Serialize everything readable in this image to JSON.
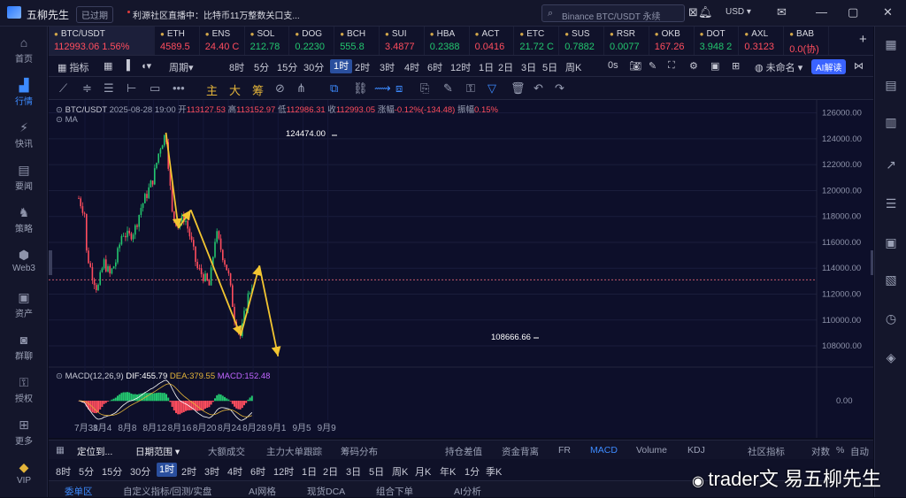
{
  "titlebar": {
    "app_name": "五柳先生",
    "badge": "已过期",
    "news": "利源社区直播中：比特币11万整数关口支...",
    "search_placeholder": "Binance BTC/USDT 永续",
    "currency": "USD"
  },
  "leftnav": [
    {
      "label": "首页",
      "icon": "home-icon"
    },
    {
      "label": "行情",
      "icon": "market-chart-icon",
      "active": true
    },
    {
      "label": "快讯",
      "icon": "flash-news-icon"
    },
    {
      "label": "要闻",
      "icon": "newspaper-icon"
    },
    {
      "label": "策略",
      "icon": "strategy-icon"
    },
    {
      "label": "Web3",
      "icon": "web3-icon"
    },
    {
      "label": "资产",
      "icon": "wallet-icon"
    },
    {
      "label": "群聊",
      "icon": "group-chat-icon"
    },
    {
      "label": "授权",
      "icon": "authorize-icon"
    },
    {
      "label": "更多",
      "icon": "more-grid-icon"
    },
    {
      "label": "VIP",
      "icon": "vip-diamond-icon"
    }
  ],
  "tickers": [
    {
      "name": "BTC/USDT",
      "price": "112993.06 1.56%",
      "dir": "dn"
    },
    {
      "name": "ETH",
      "price": "4589.5",
      "dir": "dn"
    },
    {
      "name": "ENS",
      "price": "24.40 C",
      "dir": "dn"
    },
    {
      "name": "SOL",
      "price": "212.78",
      "dir": "up"
    },
    {
      "name": "DOG",
      "price": "0.2230",
      "dir": "up"
    },
    {
      "name": "BCH",
      "price": "555.8",
      "dir": "up"
    },
    {
      "name": "SUI",
      "price": "3.4877",
      "dir": "dn"
    },
    {
      "name": "HBA",
      "price": "0.2388",
      "dir": "up"
    },
    {
      "name": "ACT",
      "price": "0.0416",
      "dir": "dn"
    },
    {
      "name": "ETC",
      "price": "21.72 C",
      "dir": "up"
    },
    {
      "name": "SUS",
      "price": "0.7882",
      "dir": "up"
    },
    {
      "name": "RSR",
      "price": "0.0077",
      "dir": "up"
    },
    {
      "name": "OKB",
      "price": "167.26",
      "dir": "dn"
    },
    {
      "name": "DOT",
      "price": "3.948 2",
      "dir": "up"
    },
    {
      "name": "AXL",
      "price": "0.3123",
      "dir": "dn"
    },
    {
      "name": "BAB",
      "price": "0.0(协)",
      "dir": "dn"
    }
  ],
  "toolbar1": {
    "items": [
      "指标",
      "周期",
      "8时",
      "5分",
      "15分",
      "30分",
      "1时",
      "2时",
      "3时",
      "4时",
      "6时",
      "12时",
      "1日",
      "2日",
      "3日",
      "5日",
      "周K",
      "0s"
    ],
    "selected": "1时",
    "layout_name": "未命名",
    "ai_button": "AI解读"
  },
  "toolbar2": {
    "gold_labels": [
      "主",
      "大",
      "筹"
    ]
  },
  "chart_info": {
    "symbol": "BTC/USDT",
    "datetime": "2025-08-28 19:00",
    "open_label": "开",
    "open": "113127.53",
    "high_label": "高",
    "high": "113152.97",
    "low_label": "低",
    "low": "112986.31",
    "close_label": "收",
    "close": "112993.05",
    "change_label": "涨幅",
    "change": "-0.12%(-134.48)",
    "amp_label": "振幅",
    "amp": "0.15%",
    "ma": "MA",
    "macd_title": "MACD(12,26,9)",
    "dif": "DIF:455.79",
    "dea": "DEA:379.55",
    "macd": "MACD:152.48",
    "high_annotation": "124474.00",
    "low_annotation": "108666.66"
  },
  "chart_data": {
    "type": "candlestick",
    "y_ticks": [
      "126000.00",
      "124000.00",
      "122000.00",
      "120000.00",
      "118000.00",
      "116000.00",
      "114000.00",
      "112000.00",
      "110000.00",
      "108000.00"
    ],
    "macd_tick": "0.00",
    "x_labels": [
      "7月31",
      "8月4",
      "8月8",
      "8月12",
      "8月16",
      "8月20",
      "8月24",
      "8月28",
      "9月1",
      "9月5",
      "9月9"
    ],
    "ylim": [
      106500,
      127000
    ],
    "price_path": [
      [
        "7月30",
        119400
      ],
      [
        "7月31",
        118200
      ],
      [
        "8月1",
        115700
      ],
      [
        "8月2",
        113800
      ],
      [
        "8月3",
        112300
      ],
      [
        "8月4",
        114500
      ],
      [
        "8月5",
        113500
      ],
      [
        "8月6",
        114600
      ],
      [
        "8月7",
        116800
      ],
      [
        "8月8",
        116400
      ],
      [
        "8月9",
        117000
      ],
      [
        "8月10",
        118700
      ],
      [
        "8月11",
        119800
      ],
      [
        "8月12",
        121000
      ],
      [
        "8月13",
        123300
      ],
      [
        "8月14",
        124474
      ],
      [
        "8月15",
        118200
      ],
      [
        "8月16",
        117300
      ],
      [
        "8月17",
        118000
      ],
      [
        "8月18",
        116200
      ],
      [
        "8月19",
        114000
      ],
      [
        "8月20",
        113400
      ],
      [
        "8月21",
        112600
      ],
      [
        "8月22",
        116800
      ],
      [
        "8月23",
        115200
      ],
      [
        "8月24",
        113600
      ],
      [
        "8月25",
        110200
      ],
      [
        "8月26",
        108666.66
      ],
      [
        "8月27",
        111600
      ],
      [
        "8月28",
        112993.05
      ]
    ],
    "drawn_trend_points": [
      [
        "8月14",
        124474
      ],
      [
        "8月16",
        117100
      ],
      [
        "8月18",
        118500
      ],
      [
        "8月26",
        108800
      ],
      [
        "8月29",
        114200
      ],
      [
        "9月1",
        107200
      ]
    ],
    "reference_line": 113100
  },
  "bottom_bar1": {
    "locate": "定位到...",
    "date_range": "日期范围",
    "items": [
      "大额成交",
      "主力大单跟踪",
      "筹码分布",
      "持仓差值",
      "资金背离",
      "FR",
      "MACD",
      "Volume",
      "KDJ",
      "社区指标",
      "对数",
      "%",
      "自动"
    ],
    "active": "MACD"
  },
  "bottom_bar2": {
    "items": [
      "8时",
      "5分",
      "15分",
      "30分",
      "1时",
      "2时",
      "3时",
      "4时",
      "6时",
      "12时",
      "1日",
      "2日",
      "3日",
      "5日",
      "周K",
      "月K",
      "年K",
      "1分",
      "季K"
    ],
    "selected": "1时"
  },
  "bottom_bar3": {
    "items": [
      "委单区",
      "自定义指标/回测/实盘",
      "AI网格",
      "现货DCA",
      "组合下单",
      "AI分析"
    ]
  },
  "watermark": "trader文 易五柳先生"
}
